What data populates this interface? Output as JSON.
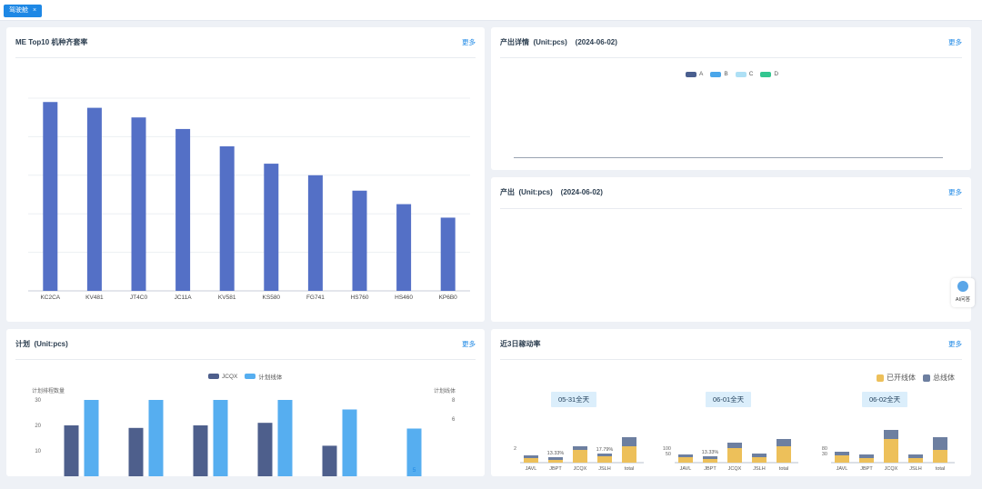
{
  "tabbar": {
    "active_tab": "驾驶舱",
    "close_glyph": "×"
  },
  "common": {
    "more_label": "更多"
  },
  "panels": {
    "top10": {
      "title": "ME Top10 机种齐套率"
    },
    "output_detail": {
      "title": "产出详情  (Unit:pcs)    (2024-06-02)",
      "legend": [
        {
          "name": "A",
          "color": "#4a5f8f"
        },
        {
          "name": "B",
          "color": "#4aa6ea"
        },
        {
          "name": "C",
          "color": "#aee0f5"
        },
        {
          "name": "D",
          "color": "#33c690"
        }
      ]
    },
    "output": {
      "title": "产出  (Unit:pcs)    (2024-06-02)"
    },
    "plan": {
      "title": "计划  (Unit:pcs)",
      "legend": [
        {
          "name": "JCQX",
          "color": "#4e5f8c"
        },
        {
          "name": "计划线体",
          "color": "#56aef0"
        }
      ],
      "left_axis_label": "计划排程数量",
      "right_axis_label": "计划线体",
      "left_ticks": [
        "30",
        "20",
        "10"
      ],
      "right_ticks": [
        "8",
        "6"
      ]
    },
    "utilization": {
      "title": "近3日稼动率",
      "legend": [
        {
          "name": "已开线体",
          "color": "#edc05a"
        },
        {
          "name": "总线体",
          "color": "#6d7fa0"
        }
      ],
      "days": [
        "05-31全天",
        "06-01全天",
        "06-02全天"
      ],
      "categories": [
        "JAVL",
        "JBPT",
        "JCQX",
        "JSLH",
        "total"
      ]
    }
  },
  "sidebar_widget": {
    "label": "AI问答",
    "icon": "chat-bot-icon"
  },
  "chart_data": [
    {
      "type": "bar",
      "title": "ME Top10 机种齐套率",
      "categories": [
        "KC2CA",
        "KV481",
        "JT4C0",
        "JC11A",
        "KV581",
        "KS580",
        "FG741",
        "HS760",
        "HS460",
        "KP6B0"
      ],
      "values": [
        98,
        95,
        90,
        84,
        75,
        66,
        60,
        52,
        45,
        38
      ],
      "ylim": [
        0,
        100
      ],
      "grid": true,
      "bar_color": "#5470c6"
    },
    {
      "type": "line",
      "title": "产出详情  (Unit:pcs)    (2024-06-02)",
      "series": [
        {
          "name": "A",
          "values": []
        },
        {
          "name": "B",
          "values": []
        },
        {
          "name": "C",
          "values": []
        },
        {
          "name": "D",
          "values": []
        }
      ]
    },
    {
      "type": "bar",
      "title": "计划  (Unit:pcs)",
      "series": [
        {
          "name": "JCQX",
          "values": [
            20,
            19,
            20,
            21,
            12,
            0
          ]
        },
        {
          "name": "计划线体",
          "values": [
            8,
            8,
            8,
            8,
            7,
            5
          ]
        }
      ],
      "labels_visible": [
        "5"
      ]
    },
    {
      "type": "bar",
      "title": "近3日稼动率",
      "groups": [
        {
          "day": "05-31全天",
          "rate_labels": [
            "",
            "13.33%",
            "",
            "17.79%",
            ""
          ]
        },
        {
          "day": "06-01全天",
          "rate_labels": [
            "",
            "13.33%",
            "",
            "",
            ""
          ]
        },
        {
          "day": "06-02全天",
          "rate_labels": [
            "",
            "",
            "",
            "",
            ""
          ]
        }
      ],
      "axis_ticks": [
        [
          "2"
        ],
        [
          "100",
          "50"
        ],
        [
          "80",
          "30"
        ]
      ]
    }
  ]
}
